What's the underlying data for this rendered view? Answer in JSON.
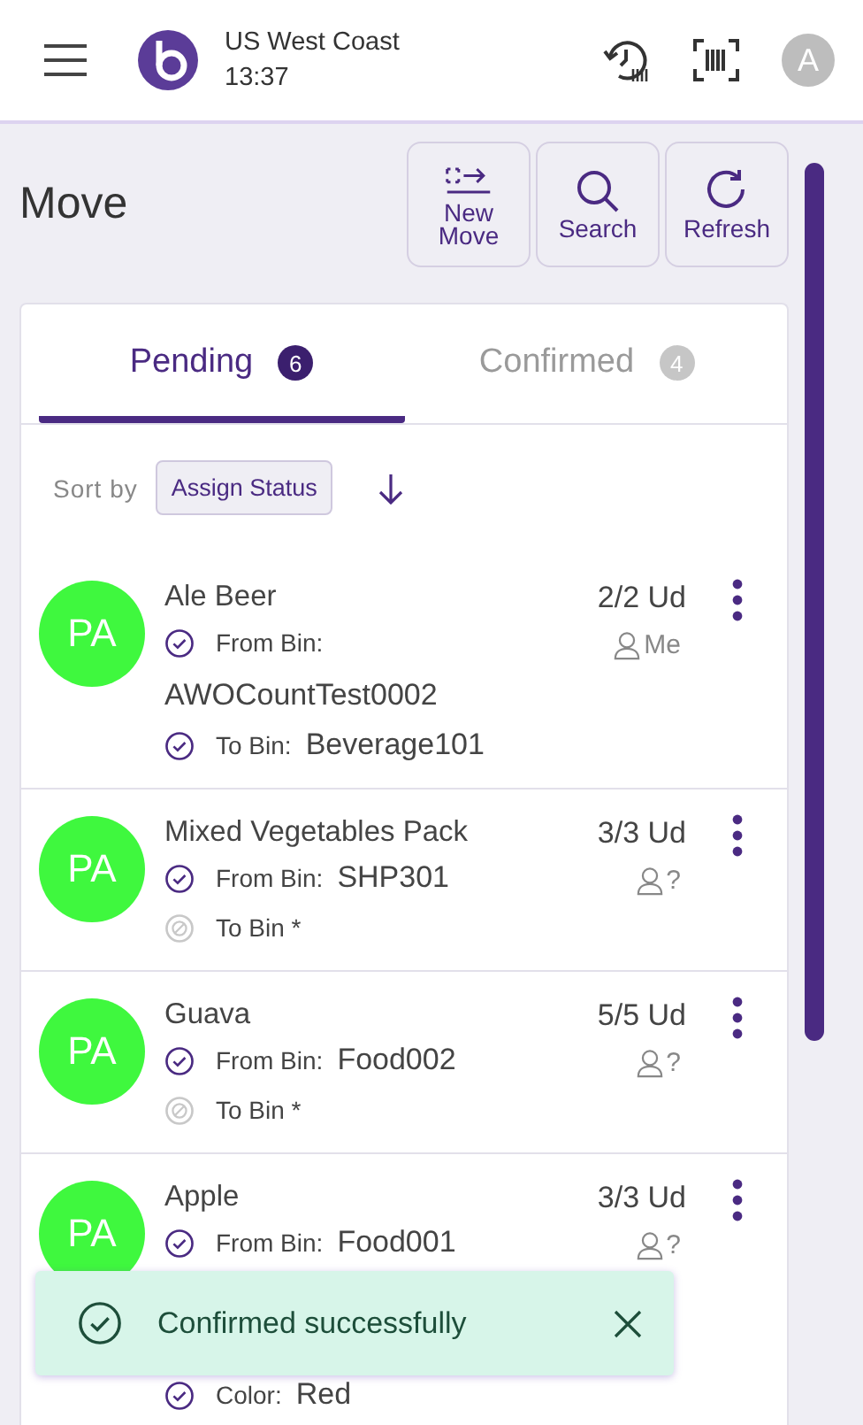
{
  "header": {
    "region": "US West Coast",
    "time": "13:37",
    "avatar": "A"
  },
  "page": {
    "title": "Move"
  },
  "actions": [
    {
      "kind": "new",
      "label": "New Move"
    },
    {
      "kind": "search",
      "label": "Search"
    },
    {
      "kind": "refresh",
      "label": "Refresh"
    }
  ],
  "tabs": [
    {
      "label": "Pending",
      "count": "6",
      "selected": true
    },
    {
      "label": "Confirmed",
      "count": "4",
      "selected": false
    }
  ],
  "sort": {
    "label": "Sort by",
    "value": "Assign Status"
  },
  "items": [
    {
      "avatar": "PA",
      "name": "Ale Beer",
      "quantity": "2/2 Ud",
      "assignee": "Me",
      "fields": [
        {
          "label": "From Bin:",
          "value": "AWOCountTest0002",
          "done": true
        },
        {
          "label": "To Bin:",
          "value": "Beverage101",
          "done": true
        }
      ]
    },
    {
      "avatar": "PA",
      "name": "Mixed Vegetables Pack",
      "quantity": "3/3 Ud",
      "assignee": "?",
      "fields": [
        {
          "label": "From Bin:",
          "value": "SHP301",
          "done": true
        },
        {
          "label": "To Bin *",
          "done": false
        }
      ]
    },
    {
      "avatar": "PA",
      "name": "Guava",
      "quantity": "5/5 Ud",
      "assignee": "?",
      "fields": [
        {
          "label": "From Bin:",
          "value": "Food002",
          "done": true
        },
        {
          "label": "To Bin *",
          "done": false
        }
      ]
    },
    {
      "avatar": "PA",
      "name": "Apple",
      "quantity": "3/3 Ud",
      "assignee": "?",
      "fields": [
        {
          "label": "From Bin:",
          "value": "Food001",
          "done": true
        },
        {
          "label": "Color:",
          "value": "Red",
          "done": true
        }
      ]
    }
  ],
  "toast": {
    "message": "Confirmed successfully"
  }
}
